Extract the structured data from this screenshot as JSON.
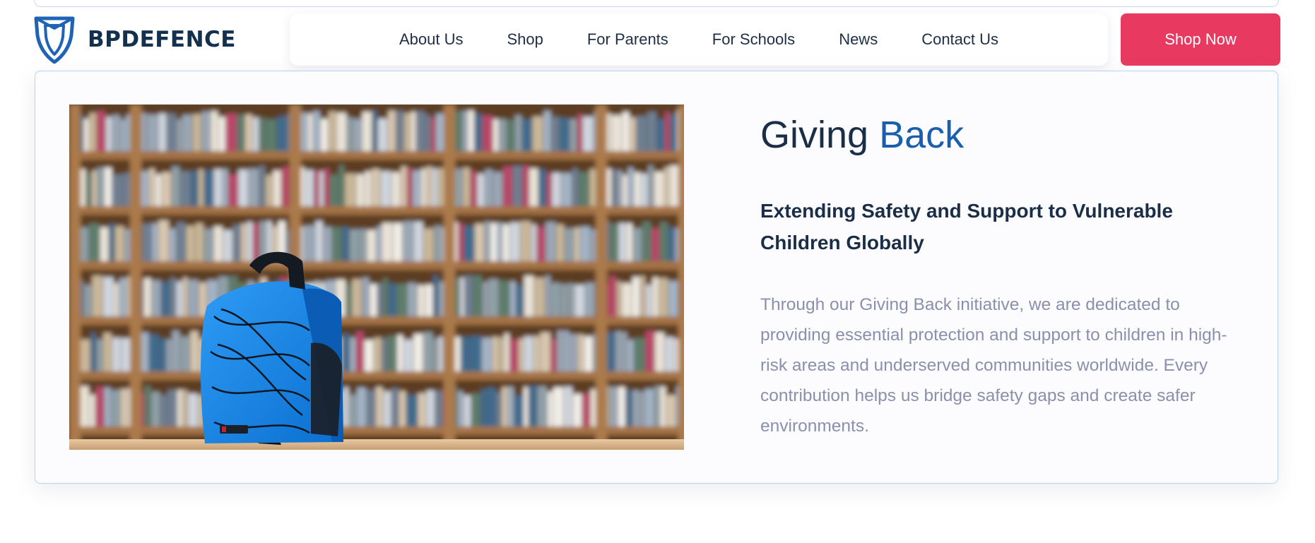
{
  "header": {
    "logo_text": "BPDEFENCE",
    "nav": [
      {
        "label": "About Us"
      },
      {
        "label": "Shop"
      },
      {
        "label": "For Parents"
      },
      {
        "label": "For Schools"
      },
      {
        "label": "News"
      },
      {
        "label": "Contact Us"
      }
    ],
    "cta_label": "Shop Now"
  },
  "section": {
    "title_part1": "Giving",
    "title_part2": "Back",
    "subtitle": "Extending Safety and Support to Vulnerable Children Globally",
    "body": "Through our Giving Back initiative, we are dedicated to providing essential protection and support to children in high-risk areas and underserved communities worldwide. Every contribution helps us bridge safety gaps and create safer environments."
  },
  "colors": {
    "brand_navy": "#14304f",
    "accent_blue": "#1a5fad",
    "cta_pink": "#e83a61",
    "body_gray": "#8a90ac"
  },
  "icons": {
    "logo": "shield-icon"
  }
}
